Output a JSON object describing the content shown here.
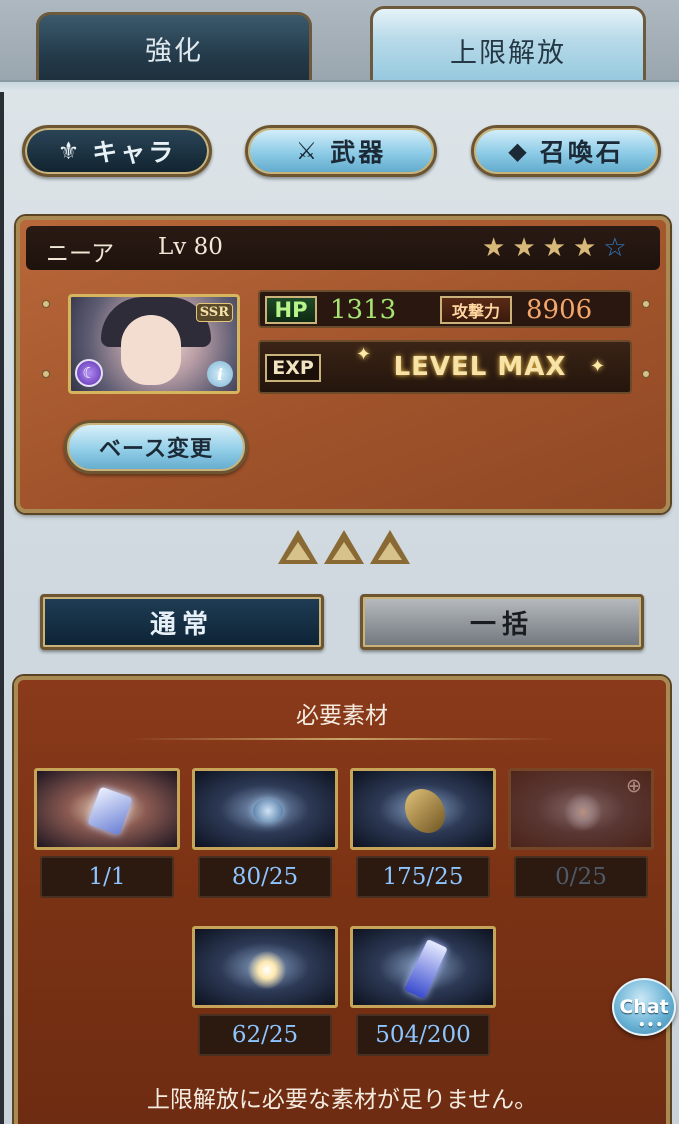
{
  "tabs": [
    {
      "label": "強化",
      "active": false
    },
    {
      "label": "上限解放",
      "active": true
    }
  ],
  "categories": {
    "chara": {
      "label": "キャラ",
      "icon": "chara-emblem-icon"
    },
    "weapon": {
      "label": "武器",
      "icon": "crossed-swords-icon"
    },
    "summon": {
      "label": "召喚石",
      "icon": "crystal-icon"
    }
  },
  "character": {
    "name": "ニーア",
    "level": "Lv 80",
    "rarity": "SSR",
    "stars_filled": 4,
    "stars_total": 5,
    "hp_label": "HP",
    "hp": "1313",
    "atk_label": "攻撃力",
    "atk": "8906",
    "exp_label": "EXP",
    "exp_status": "LEVEL MAX",
    "change_base_label": "ベース変更"
  },
  "uncap_level": 3,
  "modes": {
    "normal": "通常",
    "bulk": "一括"
  },
  "materials": {
    "title": "必要素材",
    "items": [
      {
        "count": "1/1",
        "icon": "crystal-material-icon",
        "sufficient": true
      },
      {
        "count": "80/25",
        "icon": "orb-material-icon",
        "sufficient": true
      },
      {
        "count": "175/25",
        "icon": "horn-material-icon",
        "sufficient": true
      },
      {
        "count": "0/25",
        "icon": "blue-spark-material-icon",
        "sufficient": false
      },
      {
        "count": "62/25",
        "icon": "gold-spark-material-icon",
        "sufficient": true
      },
      {
        "count": "504/200",
        "icon": "blue-crystal-material-icon",
        "sufficient": true
      }
    ],
    "warning": "上限解放に必要な素材が足りません。"
  },
  "chat": {
    "label": "Chat"
  },
  "colors": {
    "accent_blue": "#8ec4ff",
    "panel_brown": "#8a3a1a",
    "gold_border": "#c6a558",
    "hp_green": "#a6e572",
    "atk_orange": "#f5a66a"
  }
}
